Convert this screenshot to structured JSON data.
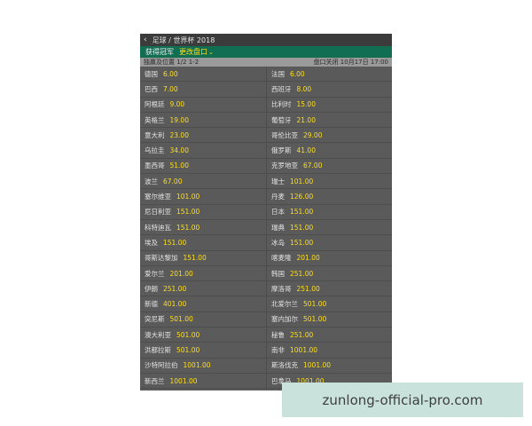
{
  "topbar": {
    "back_icon": "chevron-left-icon",
    "breadcrumb": "足球 / 世界杯 2018"
  },
  "market": {
    "title": "获得冠军",
    "switch_label": "更改盘口",
    "chevron_icon": "chevron-down-icon"
  },
  "info": {
    "left": "独赢及位置 1/2 1-2",
    "right": "盘口关闭 10月17日 17:00"
  },
  "colors": {
    "odds": "#ffdf1b",
    "green": "#126e51",
    "panel": "#5a5a5a"
  },
  "rows": [
    [
      {
        "team": "德国",
        "odds": "6.00"
      },
      {
        "team": "法国",
        "odds": "6.00"
      }
    ],
    [
      {
        "team": "巴西",
        "odds": "7.00"
      },
      {
        "team": "西班牙",
        "odds": "8.00"
      }
    ],
    [
      {
        "team": "阿根廷",
        "odds": "9.00"
      },
      {
        "team": "比利时",
        "odds": "15.00"
      }
    ],
    [
      {
        "team": "英格兰",
        "odds": "19.00"
      },
      {
        "team": "葡萄牙",
        "odds": "21.00"
      }
    ],
    [
      {
        "team": "意大利",
        "odds": "23.00"
      },
      {
        "team": "哥伦比亚",
        "odds": "29.00"
      }
    ],
    [
      {
        "team": "乌拉圭",
        "odds": "34.00"
      },
      {
        "team": "俄罗斯",
        "odds": "41.00"
      }
    ],
    [
      {
        "team": "墨西哥",
        "odds": "51.00"
      },
      {
        "team": "克罗地亚",
        "odds": "67.00"
      }
    ],
    [
      {
        "team": "波兰",
        "odds": "67.00"
      },
      {
        "team": "瑞士",
        "odds": "101.00"
      }
    ],
    [
      {
        "team": "塞尔维亚",
        "odds": "101.00"
      },
      {
        "team": "丹麦",
        "odds": "126.00"
      }
    ],
    [
      {
        "team": "尼日利亚",
        "odds": "151.00"
      },
      {
        "team": "日本",
        "odds": "151.00"
      }
    ],
    [
      {
        "team": "科特迪瓦",
        "odds": "151.00"
      },
      {
        "team": "瑞典",
        "odds": "151.00"
      }
    ],
    [
      {
        "team": "埃及",
        "odds": "151.00"
      },
      {
        "team": "冰岛",
        "odds": "151.00"
      }
    ],
    [
      {
        "team": "哥斯达黎加",
        "odds": "151.00"
      },
      {
        "team": "喀麦隆",
        "odds": "201.00"
      }
    ],
    [
      {
        "team": "爱尔兰",
        "odds": "201.00"
      },
      {
        "team": "韩国",
        "odds": "251.00"
      }
    ],
    [
      {
        "team": "伊朗",
        "odds": "251.00"
      },
      {
        "team": "摩洛哥",
        "odds": "251.00"
      }
    ],
    [
      {
        "team": "新德",
        "odds": "401.00"
      },
      {
        "team": "北爱尔兰",
        "odds": "501.00"
      }
    ],
    [
      {
        "team": "突尼斯",
        "odds": "501.00"
      },
      {
        "team": "塞内加尔",
        "odds": "501.00"
      }
    ],
    [
      {
        "team": "澳大利亚",
        "odds": "501.00"
      },
      {
        "team": "秘鲁",
        "odds": "251.00"
      }
    ],
    [
      {
        "team": "洪都拉斯",
        "odds": "501.00"
      },
      {
        "team": "南非",
        "odds": "1001.00"
      }
    ],
    [
      {
        "team": "沙特阿拉伯",
        "odds": "1001.00"
      },
      {
        "team": "斯洛伐克",
        "odds": "1001.00"
      }
    ],
    [
      {
        "team": "新西兰",
        "odds": "1001.00"
      },
      {
        "team": "巴拿马",
        "odds": "1001.00"
      }
    ]
  ],
  "watermark": "zunlong-official-pro.com"
}
